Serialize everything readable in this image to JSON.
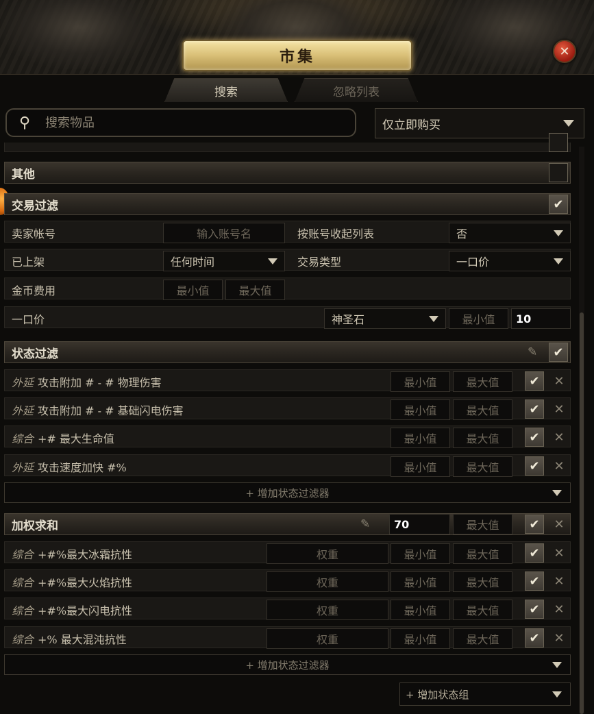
{
  "window": {
    "title": "市集",
    "close_label": "✕"
  },
  "tabs": [
    {
      "label": "搜索",
      "active": true
    },
    {
      "label": "忽略列表",
      "active": false
    }
  ],
  "search": {
    "placeholder": "搜索物品",
    "value": ""
  },
  "buy_mode": {
    "selected": "仅立即购买"
  },
  "sections": {
    "misc": {
      "label": "其他",
      "checked": false
    },
    "trade": {
      "label": "交易过滤",
      "checked": true,
      "seller_label": "卖家帐号",
      "seller_placeholder": "输入账号名",
      "collapse_label": "按账号收起列表",
      "collapse_value": "否",
      "listed_label": "已上架",
      "listed_value": "任何时间",
      "trade_type_label": "交易类型",
      "trade_type_value": "一口价",
      "fee_label": "金币费用",
      "fee_min": "最小值",
      "fee_max": "最大值",
      "price_label": "一口价",
      "price_currency": "神圣石",
      "price_min": "最小值",
      "price_value": "10"
    },
    "stat": {
      "label": "状态过滤",
      "checked": true,
      "rows": [
        {
          "prefix": "外延",
          "text": "攻击附加 # - # 物理伤害",
          "min": "最小值",
          "max": "最大值"
        },
        {
          "prefix": "外延",
          "text": "攻击附加 # - # 基础闪电伤害",
          "min": "最小值",
          "max": "最大值"
        },
        {
          "prefix": "综合",
          "text": "+# 最大生命值",
          "min": "最小值",
          "max": "最大值"
        },
        {
          "prefix": "外延",
          "text": "攻击速度加快 #%",
          "min": "最小值",
          "max": "最大值"
        }
      ],
      "add_label": "+ 增加状态过滤器"
    },
    "weighted": {
      "label": "加权求和",
      "min_value": "70",
      "max": "最大值",
      "rows": [
        {
          "prefix": "综合",
          "text": "+#%最大冰霜抗性",
          "weight": "权重",
          "min": "最小值",
          "max": "最大值"
        },
        {
          "prefix": "综合",
          "text": "+#%最大火焰抗性",
          "weight": "权重",
          "min": "最小值",
          "max": "最大值"
        },
        {
          "prefix": "综合",
          "text": "+#%最大闪电抗性",
          "weight": "权重",
          "min": "最小值",
          "max": "最大值"
        },
        {
          "prefix": "综合",
          "text": "+% 最大混沌抗性",
          "weight": "权重",
          "min": "最小值",
          "max": "最大值"
        }
      ],
      "add_label": "+ 增加状态过滤器"
    }
  },
  "add_group_label": "+ 增加状态组",
  "icons": {
    "check": "✔",
    "remove": "✕",
    "edit": "✎",
    "search": "⚲"
  }
}
